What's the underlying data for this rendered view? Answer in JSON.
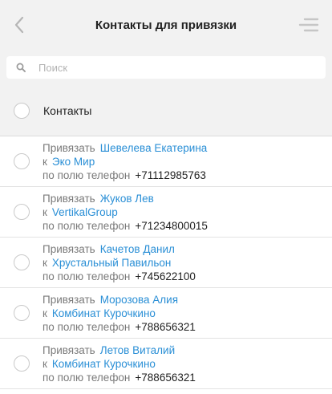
{
  "header": {
    "title": "Контакты для привязки",
    "back_icon": "chevron-left-icon",
    "menu_icon": "menu-lines-icon"
  },
  "search": {
    "placeholder": "Поиск",
    "value": ""
  },
  "select_all": {
    "label": "Контакты"
  },
  "labels": {
    "bind": "Привязать",
    "to": "к",
    "by_field": "по полю телефон"
  },
  "items": [
    {
      "name": "Шевелева Екатерина",
      "company": "Эко Мир",
      "phone": "+71112985763"
    },
    {
      "name": "Жуков Лев",
      "company": "VertikalGroup",
      "phone": "+71234800015"
    },
    {
      "name": "Качетов Данил",
      "company": "Хрустальный Павильон",
      "phone": "+745622100"
    },
    {
      "name": "Морозова Алия",
      "company": "Комбинат Курочкино",
      "phone": "+788656321"
    },
    {
      "name": "Летов Виталий",
      "company": "Комбинат Курочкино",
      "phone": "+788656321"
    }
  ],
  "colors": {
    "link": "#2a8fd6",
    "header_bg": "#f2f2f2",
    "muted": "#7a7a7a"
  }
}
